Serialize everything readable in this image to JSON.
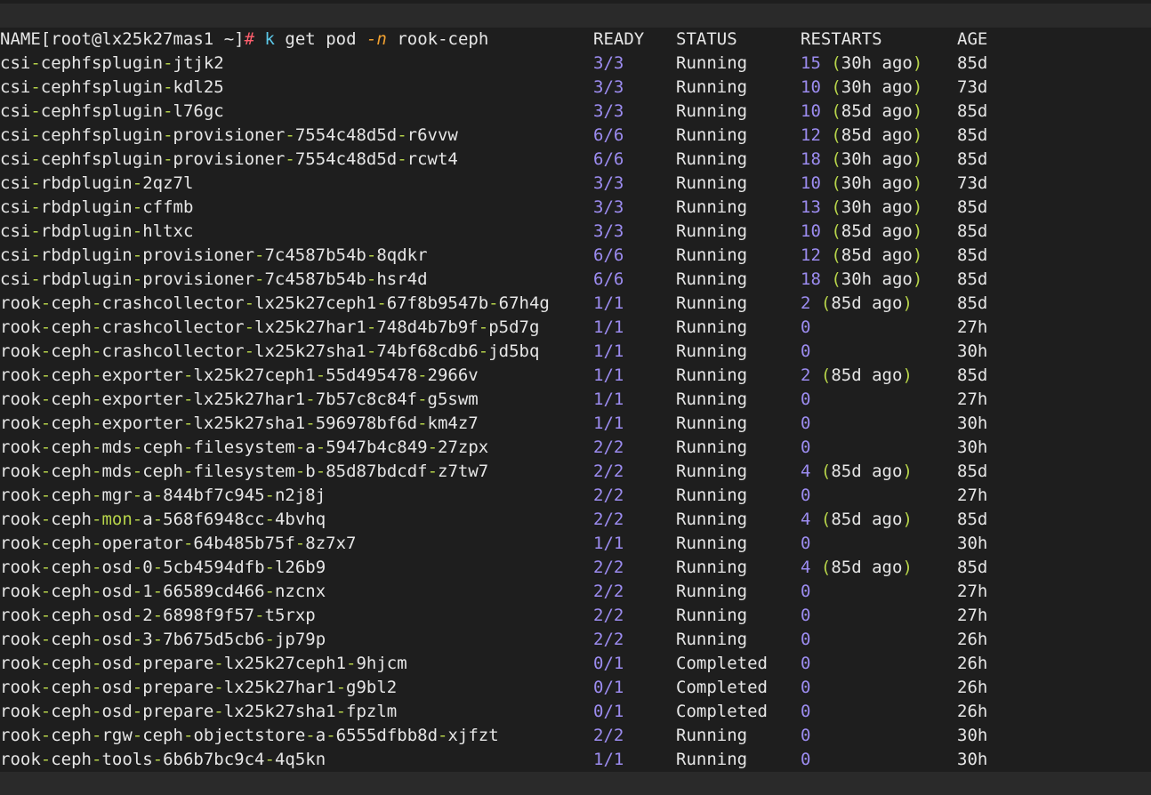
{
  "prompt": {
    "open": "[",
    "userhost": "root@lx25k27mas1",
    "path": " ~",
    "close": "]",
    "hash": "#"
  },
  "command": {
    "k": "k",
    "get": "get",
    "pod": "pod",
    "flag": "-n",
    "namespace": "rook-ceph"
  },
  "headers": {
    "name": "NAME",
    "ready": "READY",
    "status": "STATUS",
    "restarts": "RESTARTS",
    "age": "AGE"
  },
  "pods": [
    {
      "name": "csi-cephfsplugin-jtjk2",
      "ready": "3/3",
      "status": "Running",
      "restarts": "15",
      "ago": "30h ago",
      "age": "85d"
    },
    {
      "name": "csi-cephfsplugin-kdl25",
      "ready": "3/3",
      "status": "Running",
      "restarts": "10",
      "ago": "30h ago",
      "age": "73d"
    },
    {
      "name": "csi-cephfsplugin-l76gc",
      "ready": "3/3",
      "status": "Running",
      "restarts": "10",
      "ago": "85d ago",
      "age": "85d"
    },
    {
      "name": "csi-cephfsplugin-provisioner-7554c48d5d-r6vvw",
      "ready": "6/6",
      "status": "Running",
      "restarts": "12",
      "ago": "85d ago",
      "age": "85d"
    },
    {
      "name": "csi-cephfsplugin-provisioner-7554c48d5d-rcwt4",
      "ready": "6/6",
      "status": "Running",
      "restarts": "18",
      "ago": "30h ago",
      "age": "85d"
    },
    {
      "name": "csi-rbdplugin-2qz7l",
      "ready": "3/3",
      "status": "Running",
      "restarts": "10",
      "ago": "30h ago",
      "age": "73d"
    },
    {
      "name": "csi-rbdplugin-cffmb",
      "ready": "3/3",
      "status": "Running",
      "restarts": "13",
      "ago": "30h ago",
      "age": "85d"
    },
    {
      "name": "csi-rbdplugin-hltxc",
      "ready": "3/3",
      "status": "Running",
      "restarts": "10",
      "ago": "85d ago",
      "age": "85d"
    },
    {
      "name": "csi-rbdplugin-provisioner-7c4587b54b-8qdkr",
      "ready": "6/6",
      "status": "Running",
      "restarts": "12",
      "ago": "85d ago",
      "age": "85d"
    },
    {
      "name": "csi-rbdplugin-provisioner-7c4587b54b-hsr4d",
      "ready": "6/6",
      "status": "Running",
      "restarts": "18",
      "ago": "30h ago",
      "age": "85d"
    },
    {
      "name": "rook-ceph-crashcollector-lx25k27ceph1-67f8b9547b-67h4g",
      "ready": "1/1",
      "status": "Running",
      "restarts": "2",
      "ago": "85d ago",
      "age": "85d"
    },
    {
      "name": "rook-ceph-crashcollector-lx25k27har1-748d4b7b9f-p5d7g",
      "ready": "1/1",
      "status": "Running",
      "restarts": "0",
      "ago": "",
      "age": "27h"
    },
    {
      "name": "rook-ceph-crashcollector-lx25k27sha1-74bf68cdb6-jd5bq",
      "ready": "1/1",
      "status": "Running",
      "restarts": "0",
      "ago": "",
      "age": "30h"
    },
    {
      "name": "rook-ceph-exporter-lx25k27ceph1-55d495478-2966v",
      "ready": "1/1",
      "status": "Running",
      "restarts": "2",
      "ago": "85d ago",
      "age": "85d"
    },
    {
      "name": "rook-ceph-exporter-lx25k27har1-7b57c8c84f-g5swm",
      "ready": "1/1",
      "status": "Running",
      "restarts": "0",
      "ago": "",
      "age": "27h"
    },
    {
      "name": "rook-ceph-exporter-lx25k27sha1-596978bf6d-km4z7",
      "ready": "1/1",
      "status": "Running",
      "restarts": "0",
      "ago": "",
      "age": "30h"
    },
    {
      "name": "rook-ceph-mds-ceph-filesystem-a-5947b4c849-27zpx",
      "ready": "2/2",
      "status": "Running",
      "restarts": "0",
      "ago": "",
      "age": "30h"
    },
    {
      "name": "rook-ceph-mds-ceph-filesystem-b-85d87bdcdf-z7tw7",
      "ready": "2/2",
      "status": "Running",
      "restarts": "4",
      "ago": "85d ago",
      "age": "85d"
    },
    {
      "name": "rook-ceph-mgr-a-844bf7c945-n2j8j",
      "ready": "2/2",
      "status": "Running",
      "restarts": "0",
      "ago": "",
      "age": "27h"
    },
    {
      "name": "rook-ceph-mon-a-568f6948cc-4bvhq",
      "ready": "2/2",
      "status": "Running",
      "restarts": "4",
      "ago": "85d ago",
      "age": "85d"
    },
    {
      "name": "rook-ceph-operator-64b485b75f-8z7x7",
      "ready": "1/1",
      "status": "Running",
      "restarts": "0",
      "ago": "",
      "age": "30h"
    },
    {
      "name": "rook-ceph-osd-0-5cb4594dfb-l26b9",
      "ready": "2/2",
      "status": "Running",
      "restarts": "4",
      "ago": "85d ago",
      "age": "85d"
    },
    {
      "name": "rook-ceph-osd-1-66589cd466-nzcnx",
      "ready": "2/2",
      "status": "Running",
      "restarts": "0",
      "ago": "",
      "age": "27h"
    },
    {
      "name": "rook-ceph-osd-2-6898f9f57-t5rxp",
      "ready": "2/2",
      "status": "Running",
      "restarts": "0",
      "ago": "",
      "age": "27h"
    },
    {
      "name": "rook-ceph-osd-3-7b675d5cb6-jp79p",
      "ready": "2/2",
      "status": "Running",
      "restarts": "0",
      "ago": "",
      "age": "26h"
    },
    {
      "name": "rook-ceph-osd-prepare-lx25k27ceph1-9hjcm",
      "ready": "0/1",
      "status": "Completed",
      "restarts": "0",
      "ago": "",
      "age": "26h"
    },
    {
      "name": "rook-ceph-osd-prepare-lx25k27har1-g9bl2",
      "ready": "0/1",
      "status": "Completed",
      "restarts": "0",
      "ago": "",
      "age": "26h"
    },
    {
      "name": "rook-ceph-osd-prepare-lx25k27sha1-fpzlm",
      "ready": "0/1",
      "status": "Completed",
      "restarts": "0",
      "ago": "",
      "age": "26h"
    },
    {
      "name": "rook-ceph-rgw-ceph-objectstore-a-6555dfbb8d-xjfzt",
      "ready": "2/2",
      "status": "Running",
      "restarts": "0",
      "ago": "",
      "age": "30h"
    },
    {
      "name": "rook-ceph-tools-6b6b7bc9c4-4q5kn",
      "ready": "1/1",
      "status": "Running",
      "restarts": "0",
      "ago": "",
      "age": "30h"
    }
  ],
  "colors": {
    "background": "#1e1e1e",
    "prompt_bg": "#2a2a2a",
    "text": "#e6e6e6",
    "dash": "#b7d44a",
    "number": "#9c8cf0",
    "hash": "#ff5f6d",
    "command_k": "#5cc8e8",
    "flag": "#f0a030",
    "cursor": "#f5a623"
  }
}
